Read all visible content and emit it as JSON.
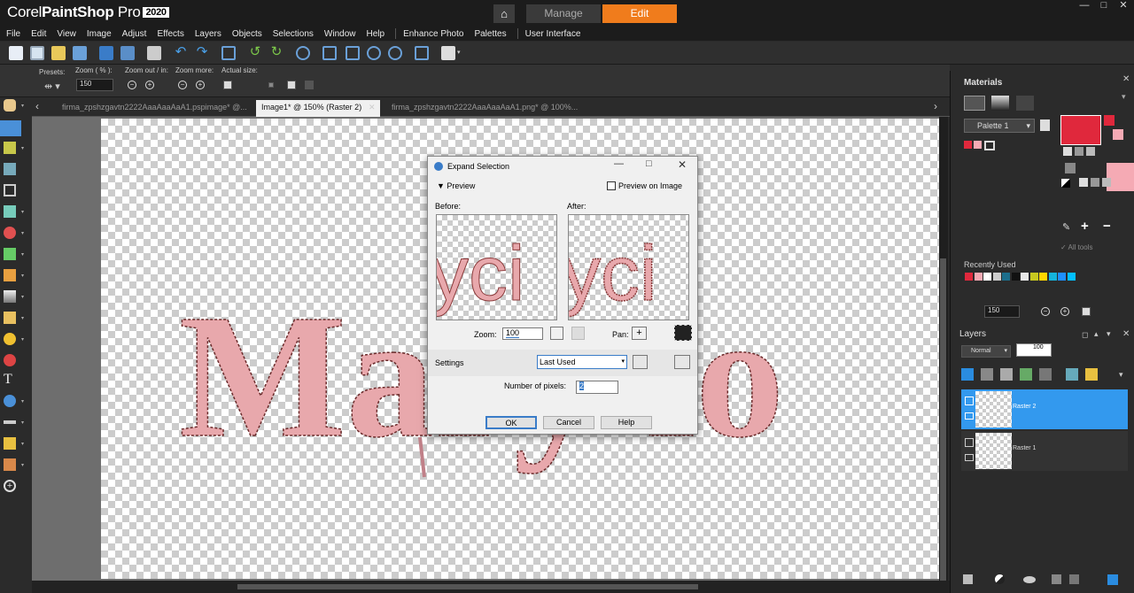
{
  "app": {
    "brand_light": "Corel",
    "brand_bold": "PaintShop",
    "brand_pro": "Pro",
    "version_badge": "2020"
  },
  "workspace_tabs": {
    "home_icon": "home-icon",
    "manage": "Manage",
    "edit": "Edit"
  },
  "window_controls": {
    "minimize": "—",
    "restore": "□",
    "close": "✕"
  },
  "menu": [
    "File",
    "Edit",
    "View",
    "Image",
    "Adjust",
    "Effects",
    "Layers",
    "Objects",
    "Selections",
    "Window",
    "Help",
    "Enhance Photo",
    "Palettes",
    "User Interface"
  ],
  "tool_options": {
    "presets_label": "Presets:",
    "zoom_label": "Zoom ( % ):",
    "zoom_value": "150",
    "zoom_out_in_label": "Zoom out / in:",
    "zoom_more_label": "Zoom more:",
    "actual_size_label": "Actual size:"
  },
  "doc_tabs": [
    {
      "label": "firma_zpshzgavtn2222AaaAaaAaA1.pspimage* @..."
    },
    {
      "label": "Image1* @ 150% (Raster 2)",
      "close": "✕"
    },
    {
      "label": "firma_zpshzgavtn2222AaaAaaAaA1.png* @ 100%..."
    }
  ],
  "canvas_text": "Mary    lo",
  "dialog": {
    "title": "Expand Selection",
    "preview_toggle": "Preview",
    "preview_on_image": "Preview on Image",
    "before_label": "Before:",
    "after_label": "After:",
    "preview_glyphs": "yci",
    "zoom_label": "Zoom:",
    "zoom_value": "100",
    "pan_label": "Pan:",
    "settings_label": "Settings",
    "settings_value": "Last Used",
    "pixels_label": "Number of pixels:",
    "pixels_value": "2",
    "ok": "OK",
    "cancel": "Cancel",
    "help": "Help"
  },
  "materials": {
    "title": "Materials",
    "palette_select": "Palette 1",
    "all_tools": "All tools",
    "recently_used": "Recently Used",
    "fg_color": "#e0283c",
    "bg_color": "#f5aab4",
    "recent_colors": [
      "#e0283c",
      "#f5aab4",
      "#ffffff",
      "#cccccc",
      "#1c6e8c",
      "#111111",
      "#e8e8e8",
      "#c8c820",
      "#ffd700",
      "#14b4dc",
      "#1e90ff",
      "#00bfff"
    ],
    "zoom_value": "150"
  },
  "layers": {
    "title": "Layers",
    "blend_mode": "Normal",
    "opacity": "100",
    "items": [
      {
        "name": "Raster 2"
      },
      {
        "name": "Raster 1"
      }
    ]
  }
}
